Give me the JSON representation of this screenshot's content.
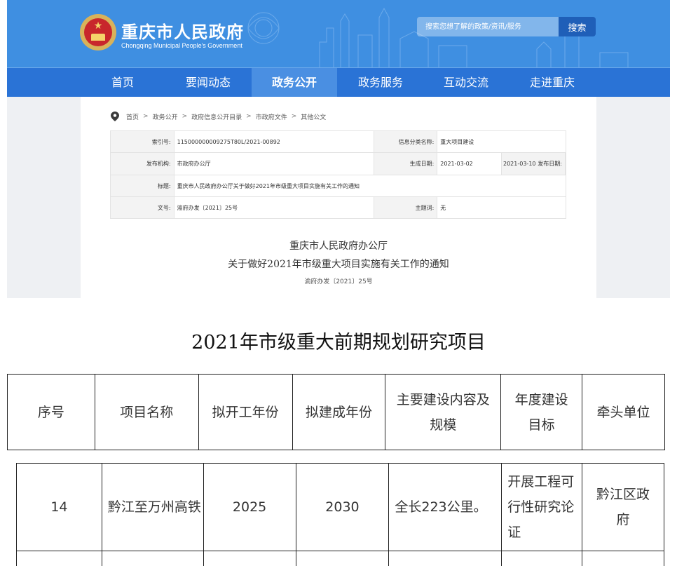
{
  "header": {
    "title": "重庆市人民政府",
    "subtitle": "Chongqing Municipal People's Government",
    "search_placeholder": "搜索您想了解的政策/资讯/服务",
    "search_button": "搜索"
  },
  "nav": {
    "items": [
      {
        "label": "首页"
      },
      {
        "label": "要闻动态"
      },
      {
        "label": "政务公开"
      },
      {
        "label": "政务服务"
      },
      {
        "label": "互动交流"
      },
      {
        "label": "走进重庆"
      }
    ],
    "active": "政务公开"
  },
  "breadcrumb": [
    "首页",
    "政务公开",
    "政府信息公开目录",
    "市政府文件",
    "其他公文"
  ],
  "info": {
    "index_label": "索引号:",
    "index_value": "11500000000927​5T80L/2021-00892",
    "category_label": "信息分类名称:",
    "category_value": "重大项目建设",
    "publisher_label": "发布机构:",
    "publisher_value": "市政府办公厅",
    "created_label": "生成日期:",
    "created_value": "2021-03-02",
    "published_label": "发布日期:",
    "published_value": "2021-03-10",
    "title_label": "标题:",
    "title_value": "重庆市人民政府办公厅关于做好2021年市级重大项目实施有关工作的通知",
    "docno_label": "文号:",
    "docno_value": "渝府办发〔2021〕25号",
    "subject_label": "主题词:",
    "subject_value": "无"
  },
  "document": {
    "org": "重庆市人民政府办公厅",
    "title": "关于做好2021年市级重大项目实施有关工作的通知",
    "number": "渝府办发〔2021〕25号"
  },
  "section_title": "2021年市级重大前期规划研究项目",
  "table": {
    "headers": [
      "序号",
      "项目名称",
      "拟开工年份",
      "拟建成年份",
      "主要建设内容及规模",
      "年度建设目标",
      "牵头单位"
    ],
    "rows": [
      [
        "14",
        "黔江至万州高铁",
        "2025",
        "2030",
        "全长223公里。",
        "开展工程可行性研究论证",
        "黔江区政府"
      ]
    ]
  },
  "colors": {
    "header_blue": "#3f8fe1",
    "nav_blue": "#2a73d6",
    "nav_active": "#4a8fe2",
    "search_button": "#1f5fb8"
  }
}
